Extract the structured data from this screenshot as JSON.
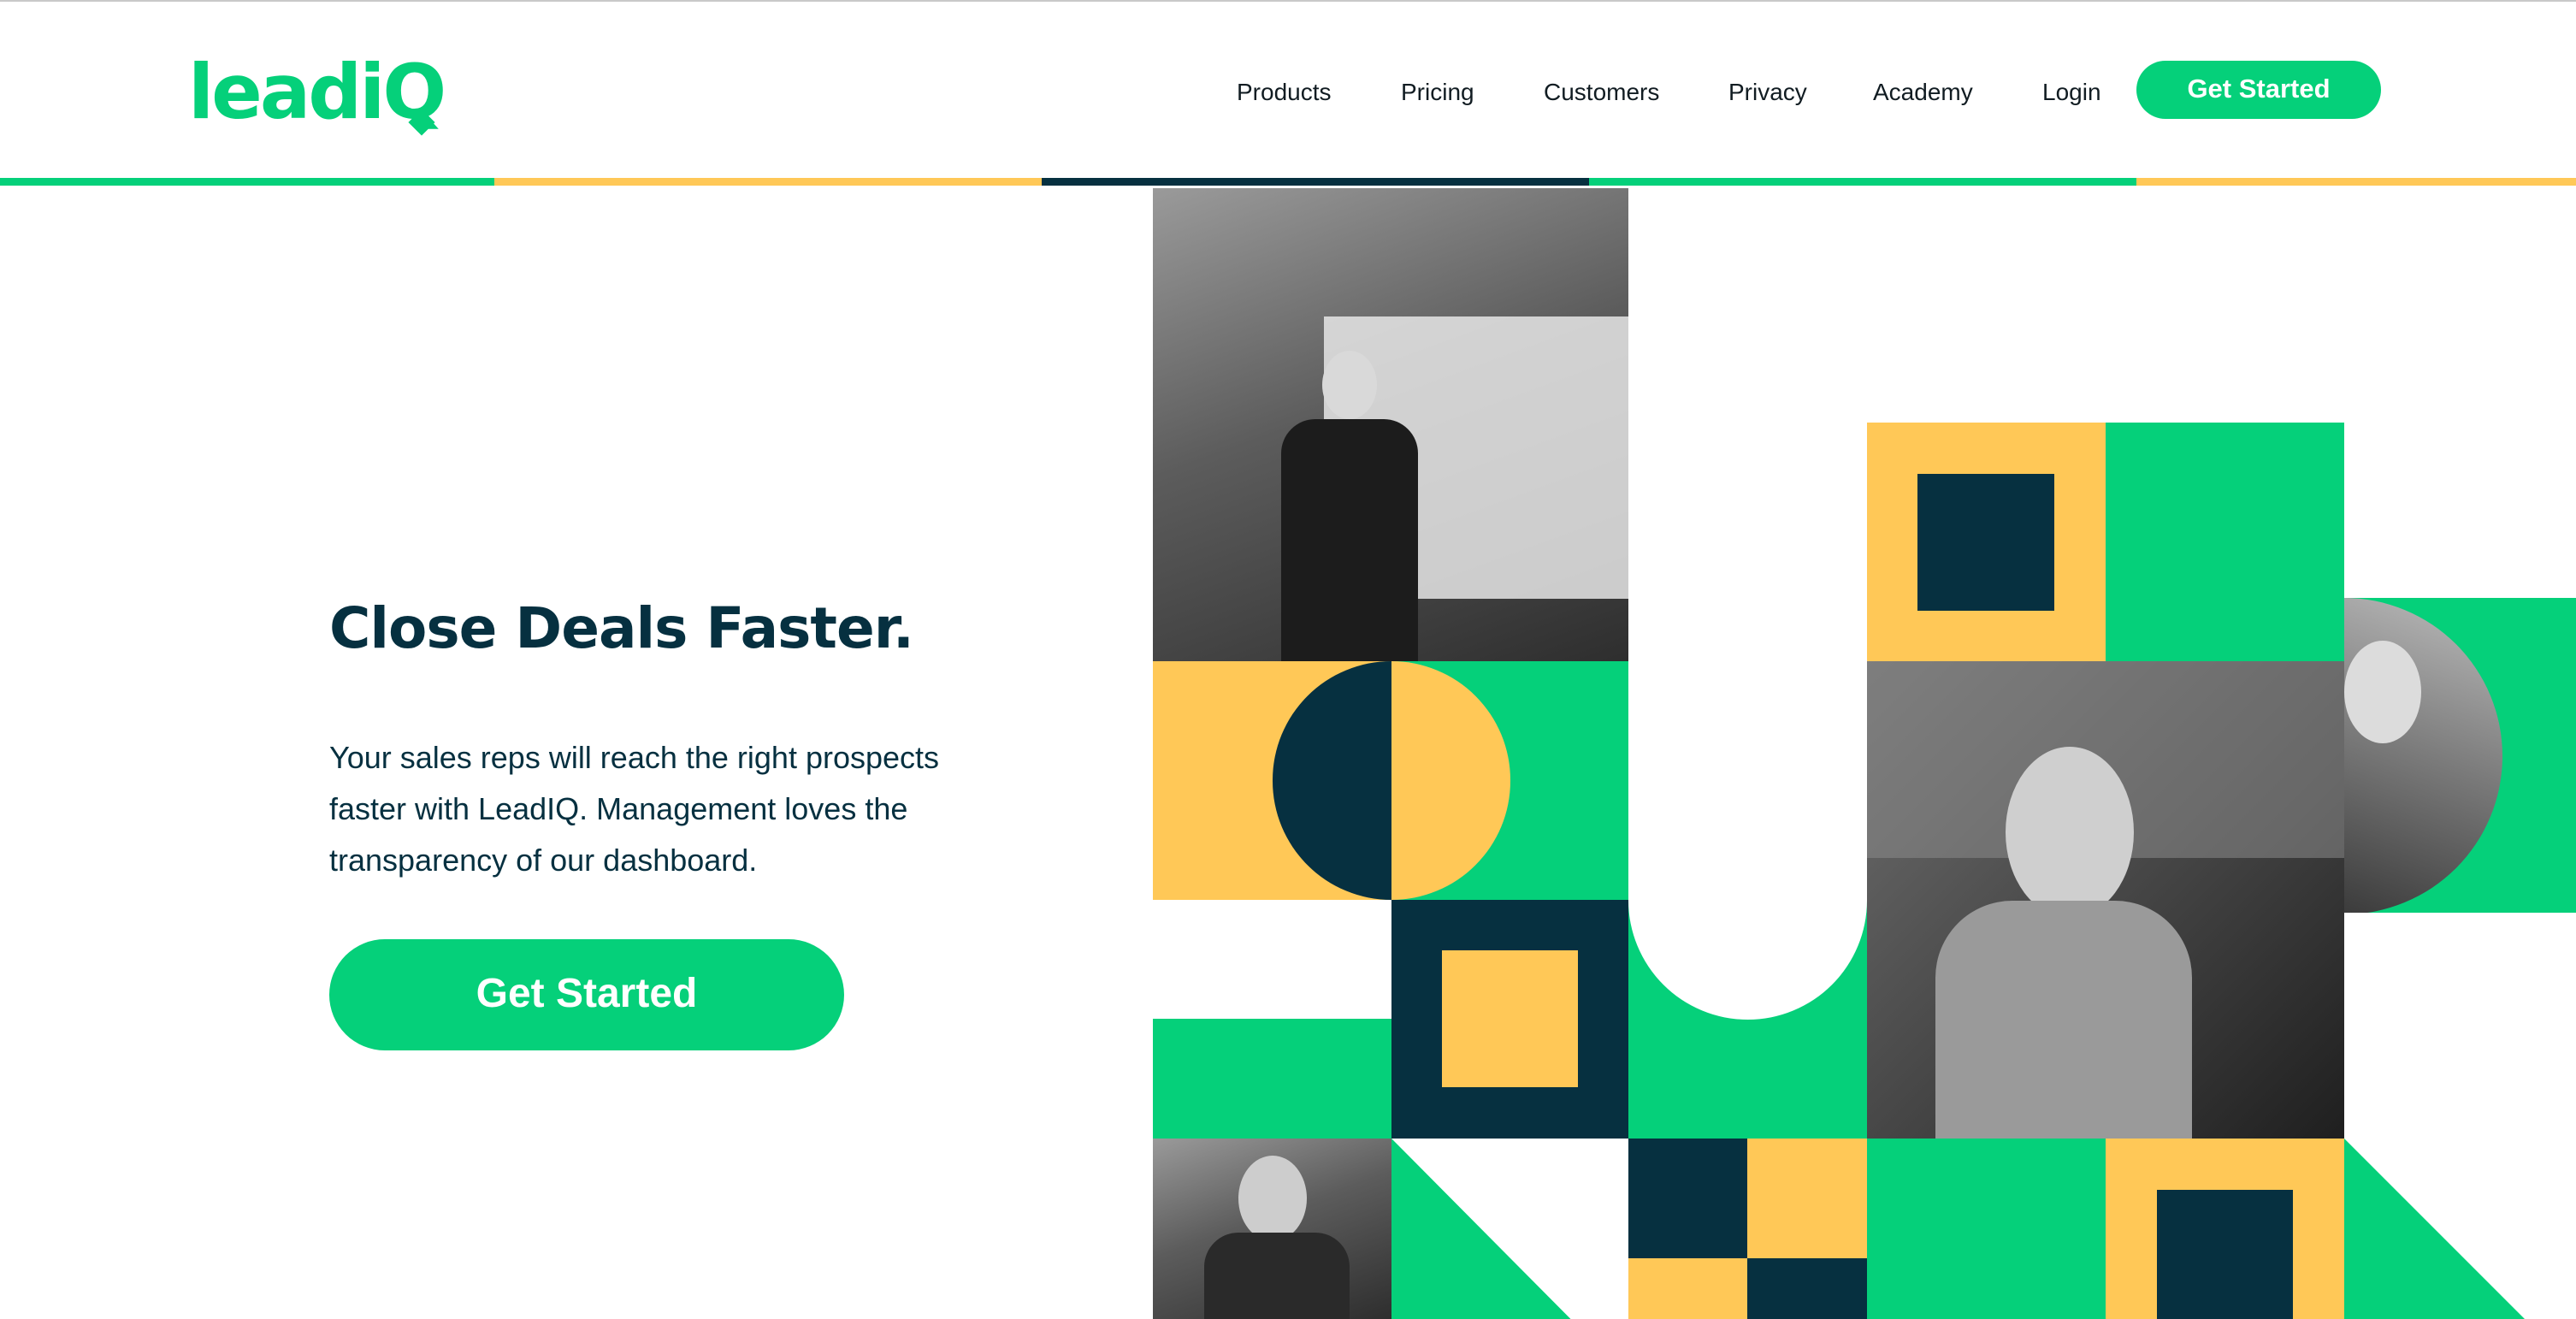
{
  "brand": {
    "logo_text": "leadiQ",
    "colors": {
      "green": "#05d07a",
      "yellow": "#ffc857",
      "navy": "#063040"
    }
  },
  "nav": {
    "items": [
      "Products",
      "Pricing",
      "Customers",
      "Privacy",
      "Academy",
      "Login"
    ],
    "cta_label": "Get Started"
  },
  "hero": {
    "title": "Close Deals Faster.",
    "body": "Your sales reps will reach the right prospects faster with LeadIQ. Management loves the transparency of our dashboard.",
    "cta_label": "Get Started"
  },
  "images": [
    {
      "name": "presenter-photo"
    },
    {
      "name": "smiling-man-photo"
    },
    {
      "name": "woman-with-glasses-photo"
    },
    {
      "name": "woman-on-phone-photo"
    }
  ]
}
